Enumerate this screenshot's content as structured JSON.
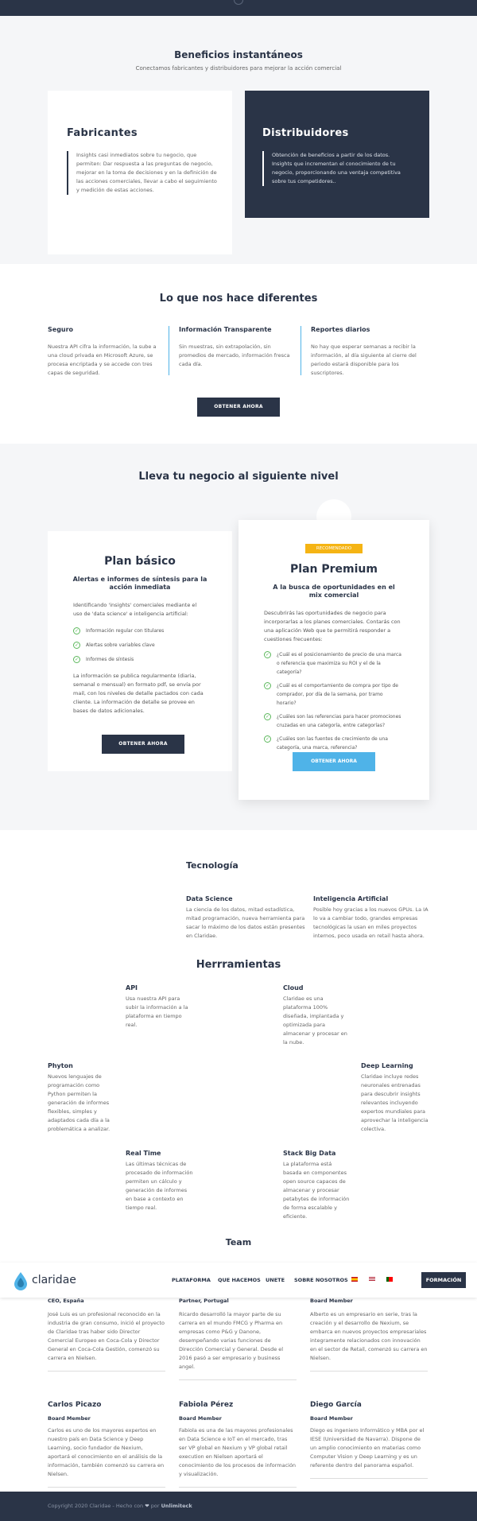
{
  "benefits": {
    "title": "Beneficios instantáneos",
    "subtitle": "Conectamos fabricantes y distribuidores para mejorar la acción comercial",
    "fabricantes": {
      "title": "Fabricantes",
      "text": "Insights casi inmediatos sobre tu negocio, que permiten: Dar respuesta a las preguntas de negocio, mejorar en la toma de decisiones y en la definición de las acciones comerciales, llevar a cabo el seguimiento y medición de estas acciones."
    },
    "distribuidores": {
      "title": "Distribuidores",
      "text": "Obtención de beneficios a partir de los datos. Insights que incrementan el conocimiento de tu negocio, proporcionando una ventaja competitiva sobre tus competidores.."
    }
  },
  "different": {
    "title": "Lo que nos hace diferentes",
    "items": [
      {
        "title": "Seguro",
        "text": "Nuestra API cifra la información, la sube a una cloud privada en Microsoft Azure, se procesa encriptada y se accede con tres capas de seguridad."
      },
      {
        "title": "Información Transparente",
        "text": "Sin muestras, sin extrapolación, sin promedios de mercado, información fresca cada día."
      },
      {
        "title": "Reportes diarios",
        "text": "No hay que esperar semanas a recibir la información, al día siguiente al cierre del periodo estará disponible para los suscriptores."
      }
    ],
    "button": "OBTENER AHORA"
  },
  "plans": {
    "title": "Lleva tu negocio al siguiente nivel",
    "basic": {
      "title": "Plan básico",
      "subtitle": "Alertas e informes de síntesis para la acción inmediata",
      "intro": "Identificando 'insights' comerciales mediante el uso de 'data science' e inteligencia artificial:",
      "features": [
        "Información regular con titulares",
        "Alertas sobre variables clave",
        "Informes de síntesis"
      ],
      "outro": "La información se publica regularmente (diaria, semanal o mensual) en formato pdf, se envía por mail, con los niveles de detalle pactados con cada cliente. La información de detalle se provee en bases de datos adicionales.",
      "button": "OBTENER AHORA"
    },
    "premium": {
      "badge": "RECOMENDADO",
      "title": "Plan Premium",
      "subtitle": "A la busca de oportunidades en el mix comercial",
      "intro": "Descubrirás las oportunidades de negocio para incorporarlas a los planes comerciales. Contarás con una aplicación Web que te permitirá responder a cuestiones frecuentes:",
      "features": [
        "¿Cuál es el posicionamiento de precio de una marca o referencia que maximiza su ROI y el de la categoría?",
        "¿Cuál es el comportamiento de compra por tipo de comprador, por día de la semana, por tramo horario?",
        "¿Cuáles son las referencias para hacer promociones cruzadas en una categoría, entre categorías?",
        "¿Cuáles son las fuentes de crecimiento de una categoría, una marca, referencia?"
      ],
      "button": "OBTENER AHORA"
    }
  },
  "tech": {
    "title": "Tecnología",
    "items": [
      {
        "title": "Data Science",
        "text": "La ciencia de los datos, mitad estadística, mitad programación, nueva herramienta para sacar lo máximo de los datos están presentes en Claridae."
      },
      {
        "title": "Inteligencia Artificial",
        "text": "Posible hoy gracias a los nuevos GPUs. La IA lo va a cambiar todo, grandes empresas tecnológicas la usan en miles proyectos internos, poco usada en retail hasta ahora."
      }
    ]
  },
  "tools": {
    "title": "Herrramientas",
    "items": [
      {
        "title": "API",
        "text": "Usa nuestra API para subir la información a la plataforma en tiempo real."
      },
      {
        "title": "Cloud",
        "text": "Claridae es una plataforma 100% diseñada, implantada y optimizada para almacenar y procesar en la nube."
      },
      {
        "title": "Phyton",
        "text": "Nuevos lenguajes de programación como Python permiten la generación de informes flexibles, simples y adaptados cada día a la problemática a analizar."
      },
      {
        "title": "Deep Learning",
        "text": "Claridae incluye redes neuronales entrenadas para descubrir insights relevantes incluyendo expertos mundiales para aprovechar la inteligencia colectiva."
      },
      {
        "title": "Real Time",
        "text": "Las últimas técnicas de procesado de información permiten un cálculo y generación de informes en base a contexto en tiempo real."
      },
      {
        "title": "Stack Big Data",
        "text": "La plataforma está basada en componentes open source capaces de almacenar y procesar petabytes de información de forma escalable y eficiente."
      }
    ]
  },
  "team": {
    "title": "Team",
    "members": [
      {
        "role": "CEO, España",
        "text": "José Luis es un profesional reconocido en la industria de gran consumo, inició el proyecto de Claridae tras haber sido Director Comercial Europeo en Coca-Cola y Director General en Coca-Cola Gestión, comenzó su carrera en Nielsen."
      },
      {
        "role": "Partner, Portugal",
        "text": "Ricardo desarrolló la mayor parte de su carrera en el mundo FMCG y Pharma en empresas como P&G y Danone, desempeñando varias funciones de Dirección Comercial y General. Desde el 2016 pasó a ser empresario y business angel."
      },
      {
        "role": "Board Member",
        "text": "Alberto es un empresario en serie, tras la creación y el desarrollo de Nexium, se embarca en nuevos proyectos empresariales integramente relacionados con innovación en el sector de Retail, comenzó su carrera en Nielsen."
      },
      {
        "name": "Carlos Picazo",
        "role": "Board Member",
        "text": "Carlos es uno de los mayores expertos en nuestro país en Data Science y Deep Learning, socio fundador de Nexium, aportará el conocimiento en el análisis de la información, también comenzó su carrera en Nielsen."
      },
      {
        "name": "Fabiola Pérez",
        "role": "Board Member",
        "text": "Fabiola es una de las mayores profesionales en Data Science e IoT en el mercado, tras ser VP global en Nexium y VP global retail execution en Nielsen aportará el conocimiento de los procesos de información y visualización."
      },
      {
        "name": "Diego García",
        "role": "Board Member",
        "text": "Diego es ingeniero Informático y MBA por el IESE (Universidad de Navarra). Dispone de un amplio conocimiento en materias como Computer Vision y Deep Learning y es un referente dentro del panorama español."
      }
    ]
  },
  "nav": {
    "brand": "claridae",
    "items": [
      "PLATAFORMA",
      "QUE HACEMOS",
      "UNETE",
      "SOBRE NOSOTROS"
    ],
    "cta": "FORMACIÓN",
    "colors": {
      "primary": "#2a3447",
      "accent": "#4fb3e8",
      "badge": "#f5b414",
      "check": "#5cb85c"
    }
  },
  "footer": {
    "prefix": "Copyright 2020 Claridae - Hecho con",
    "heart": "❤",
    "by": "por",
    "author": "Unlimiteck"
  }
}
